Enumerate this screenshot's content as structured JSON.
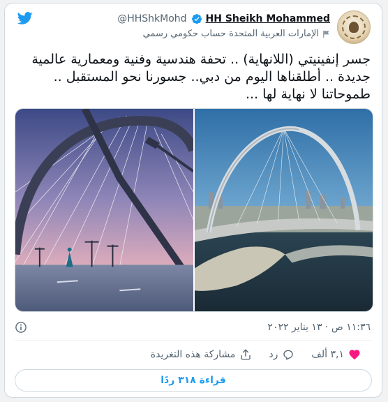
{
  "author": {
    "handle": "@HHShkMohd",
    "display_name": "HH Sheikh Mohammed",
    "affiliation": "الإمارات العربية المتحدة حساب حكومي رسمي"
  },
  "tweet": {
    "text": "جسر إنفينيتي (اللانهاية) .. تحفة هندسية وفنية ومعمارية عالمية جديدة .. أطلقناها اليوم من دبي.. جسورنا نحو المستقبل .. طموحاتنا لا نهاية لها ...",
    "timestamp": "١١:٣٦ ص · ١٣ يناير ٢٠٢٢"
  },
  "actions": {
    "like_count": "٣,١ ألف",
    "reply_label": "رد",
    "share_label": "مشاركة هذه التغريدة"
  },
  "read_replies_label": "قراءة ٣١٨ ردًا",
  "icons": {
    "logo": "twitter-bird-icon",
    "verified": "verified-badge-icon",
    "government": "flag-icon",
    "info": "info-icon",
    "like": "heart-icon",
    "reply": "reply-icon",
    "share": "share-icon"
  },
  "colors": {
    "accent": "#1d9bf0",
    "like": "#f91880",
    "text": "#0f1419",
    "secondary": "#536471"
  }
}
